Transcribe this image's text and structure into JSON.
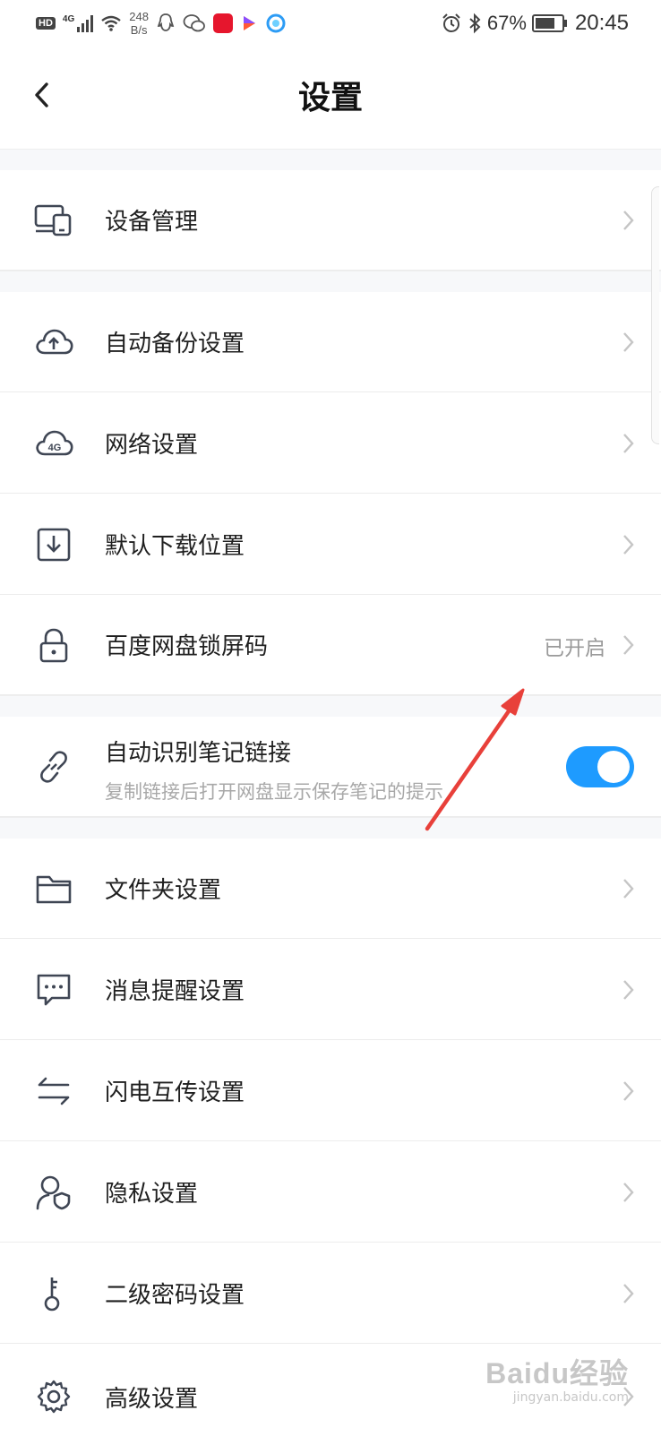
{
  "status_bar": {
    "hd": "HD",
    "network": "4G",
    "speed_value": "248",
    "speed_unit": "B/s",
    "battery": "67%",
    "time": "20:45"
  },
  "header": {
    "title": "设置"
  },
  "items": [
    {
      "label": "设备管理",
      "icon": "devices-icon"
    },
    {
      "label": "自动备份设置",
      "icon": "cloud-upload-icon"
    },
    {
      "label": "网络设置",
      "icon": "cloud-4g-icon",
      "icon_text": "4G"
    },
    {
      "label": "默认下载位置",
      "icon": "download-icon"
    },
    {
      "label": "百度网盘锁屏码",
      "icon": "lock-icon",
      "value": "已开启"
    },
    {
      "label": "自动识别笔记链接",
      "sub": "复制链接后打开网盘显示保存笔记的提示",
      "icon": "link-icon",
      "toggle_on": true
    },
    {
      "label": "文件夹设置",
      "icon": "folder-icon"
    },
    {
      "label": "消息提醒设置",
      "icon": "message-icon"
    },
    {
      "label": "闪电互传设置",
      "icon": "transfer-icon"
    },
    {
      "label": "隐私设置",
      "icon": "privacy-icon"
    },
    {
      "label": "二级密码设置",
      "icon": "key-icon"
    },
    {
      "label": "高级设置",
      "icon": "gear-icon"
    }
  ],
  "colors": {
    "toggle_on": "#1e9bff",
    "annotation_arrow": "#e8403a",
    "icon_stroke": "#3f4654"
  },
  "watermark": {
    "logo": "Baidu经验",
    "url": "jingyan.baidu.com"
  }
}
